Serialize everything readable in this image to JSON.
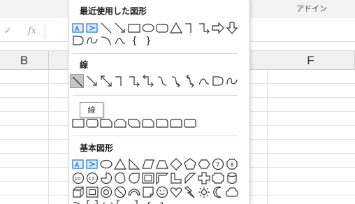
{
  "ribbon": {
    "addin_tab_label": "アドイン"
  },
  "formula_bar": {
    "enter_icon": "check-icon",
    "function_label": "fx"
  },
  "columns": {
    "b": "B",
    "f": "F"
  },
  "shapes_menu": {
    "sections": [
      {
        "id": "recent",
        "title": "最近使用した図形"
      },
      {
        "id": "lines",
        "title": "線"
      },
      {
        "id": "rectangles",
        "title": ""
      },
      {
        "id": "basic",
        "title": "基本図形"
      }
    ],
    "tooltip": "線",
    "selected_shape": "line"
  }
}
